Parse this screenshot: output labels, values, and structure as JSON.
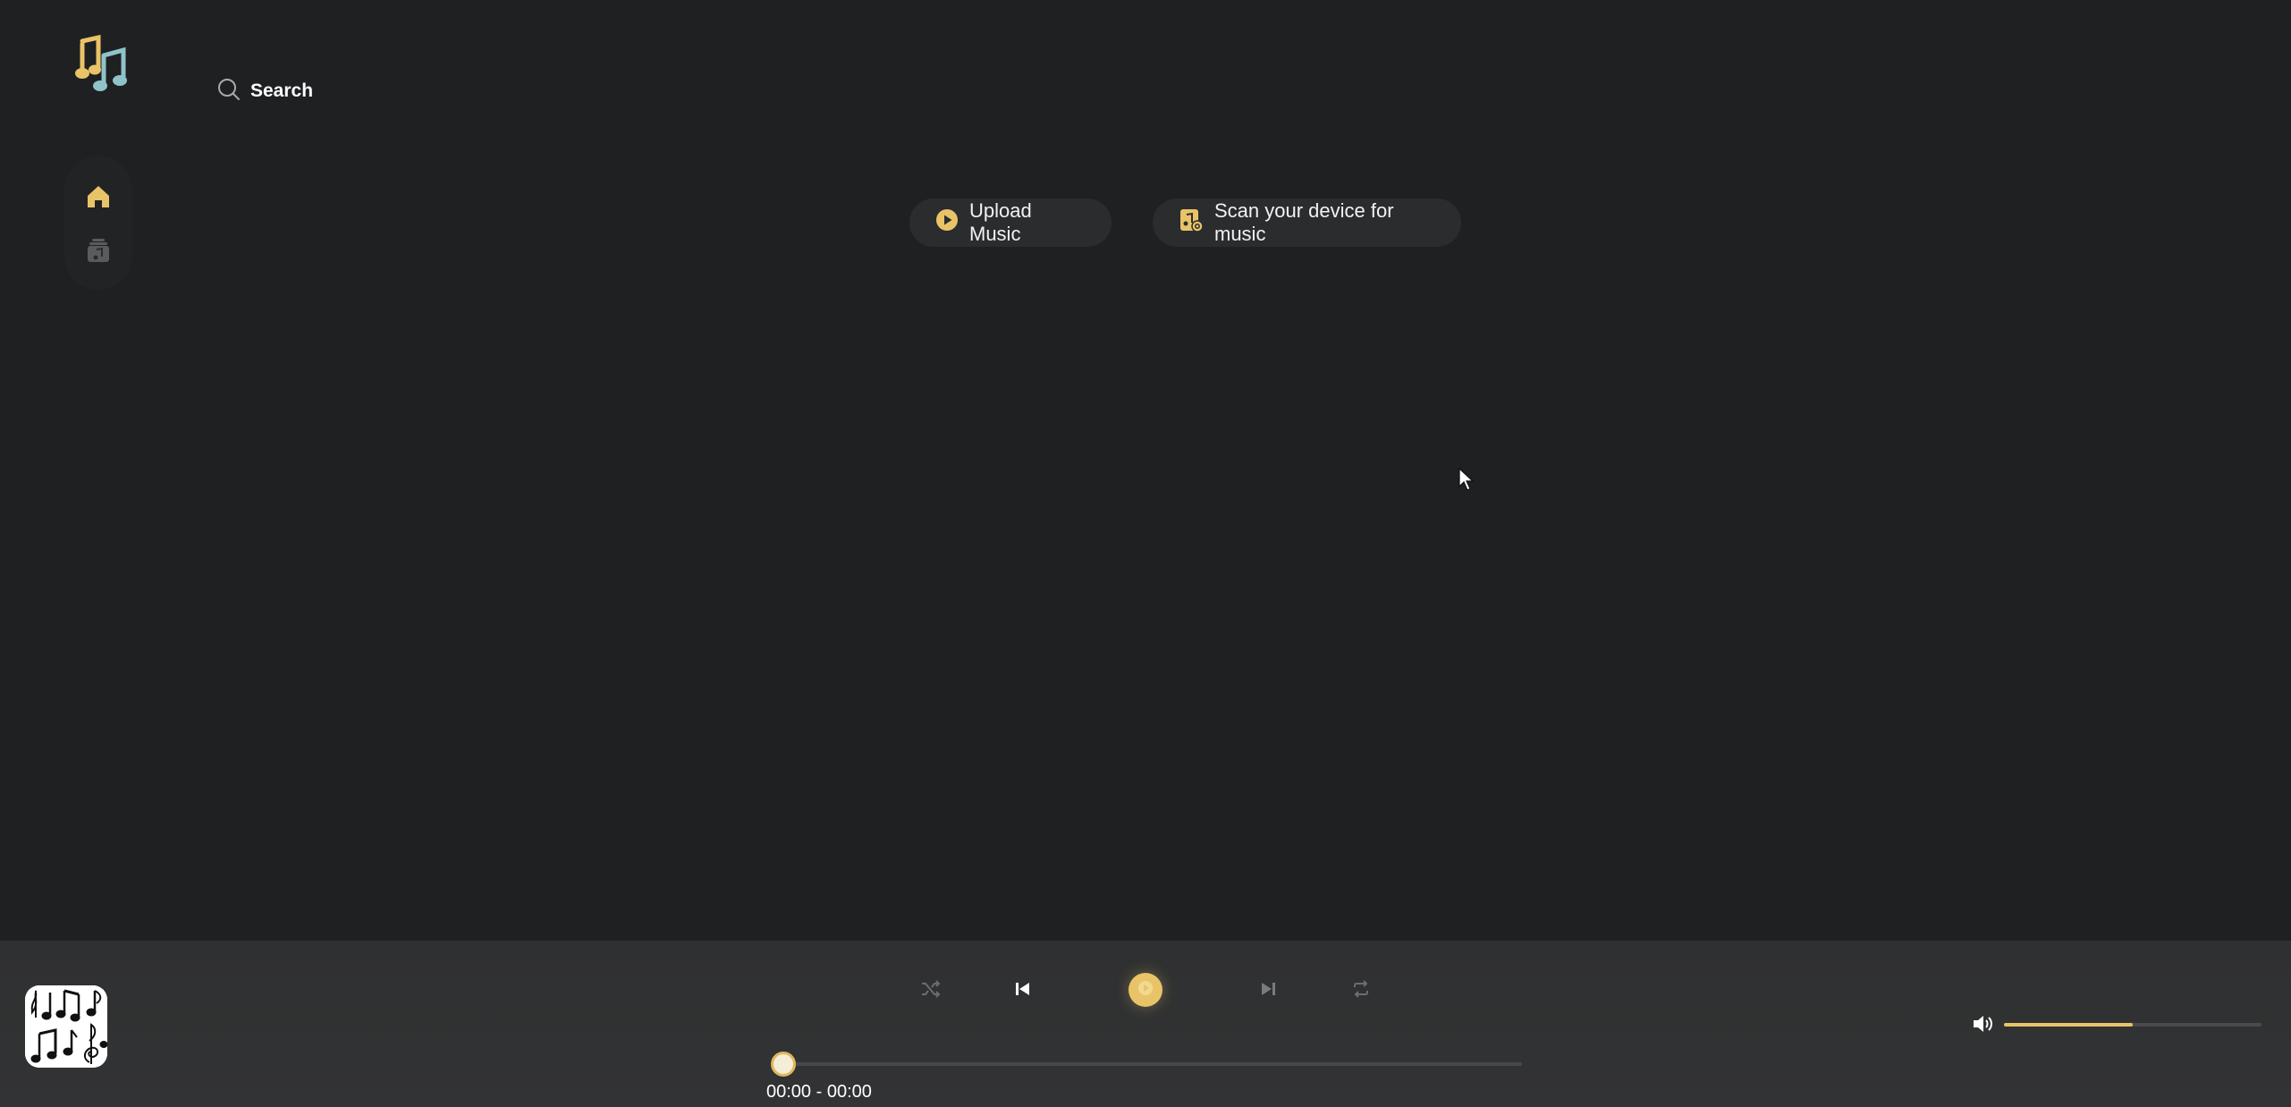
{
  "header": {
    "logo_icon": "music-notes-icon",
    "search_label": "Search",
    "search_icon": "search-icon"
  },
  "sidebar": {
    "items": [
      {
        "name": "home",
        "icon": "home-icon",
        "active": true
      },
      {
        "name": "library",
        "icon": "music-library-icon",
        "active": false
      }
    ]
  },
  "actions": {
    "upload_label": "Upload Music",
    "upload_icon": "play-circle-icon",
    "scan_label": "Scan your device for music",
    "scan_icon": "music-file-scan-icon"
  },
  "player": {
    "cover_icon": "music-notes-cover-art",
    "controls": [
      "shuffle-icon",
      "previous-icon",
      "play-icon",
      "next-icon",
      "repeat-icon"
    ],
    "current_time": "00:00",
    "total_time": "00:00",
    "time_display": "00:00 - 00:00",
    "progress": 0,
    "volume": 0.5
  },
  "colors": {
    "accent": "#e8c368",
    "background": "#1f2022",
    "player_bar": "#313233",
    "pill": "#2a2c2d"
  }
}
